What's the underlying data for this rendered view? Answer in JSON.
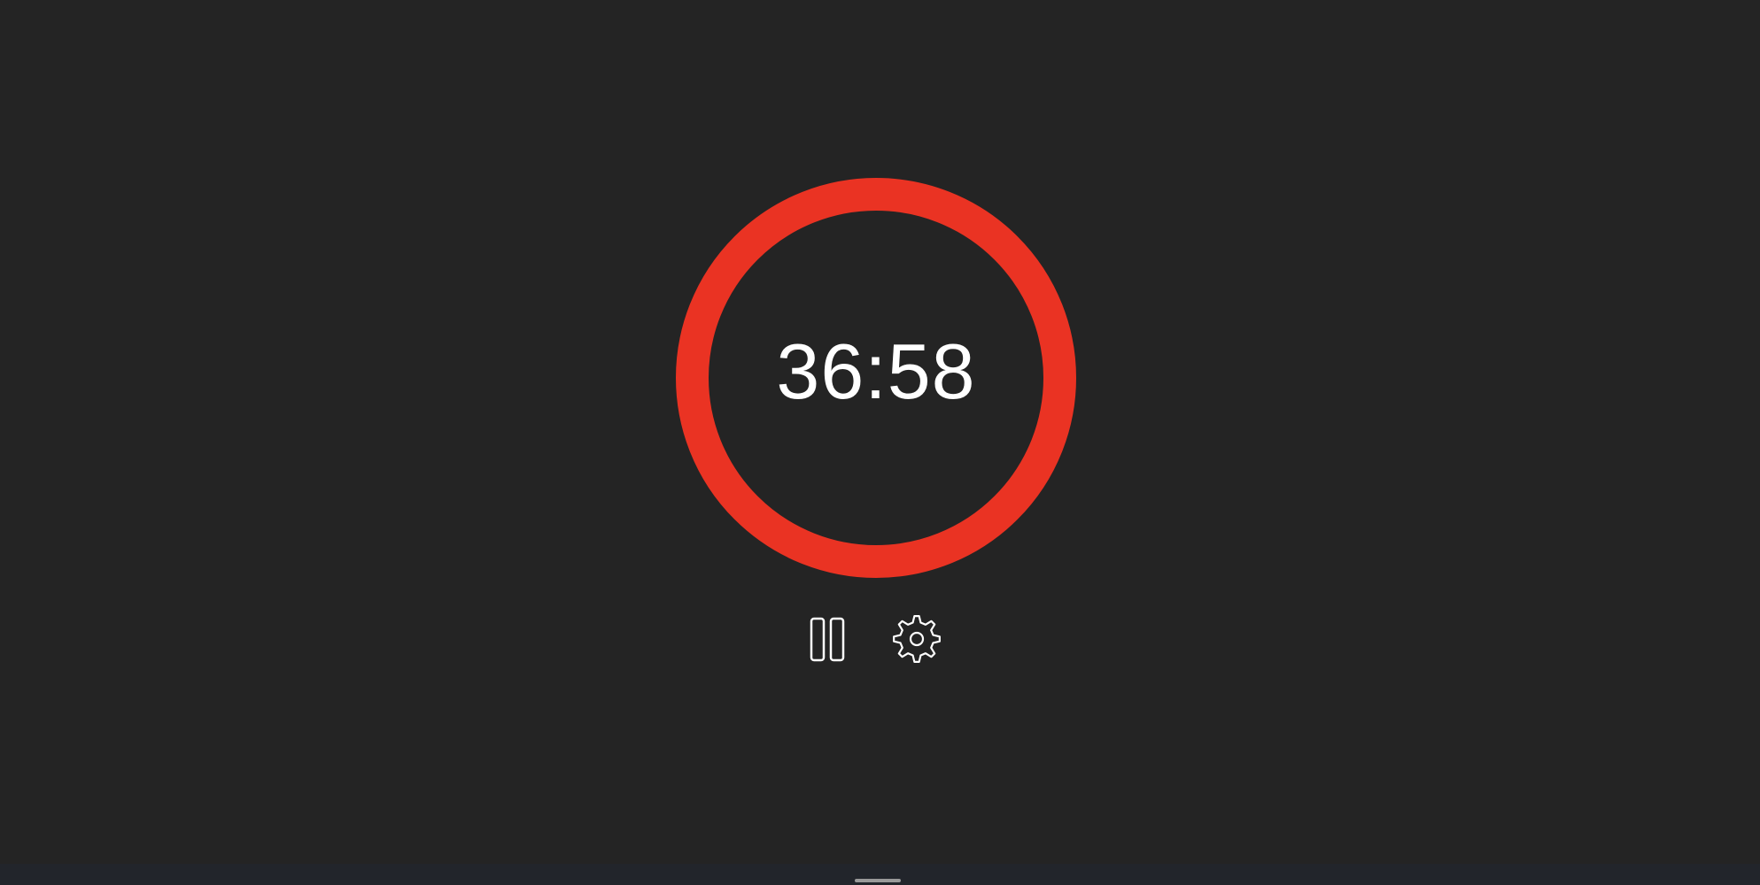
{
  "timer": {
    "time_remaining": "36:58",
    "ring_color": "#EA3323",
    "progress": 1.0
  },
  "controls": {
    "pause_icon": "pause-icon",
    "settings_icon": "gear-icon",
    "icon_color": "#FFFFFF"
  },
  "theme": {
    "background": "#242424"
  }
}
